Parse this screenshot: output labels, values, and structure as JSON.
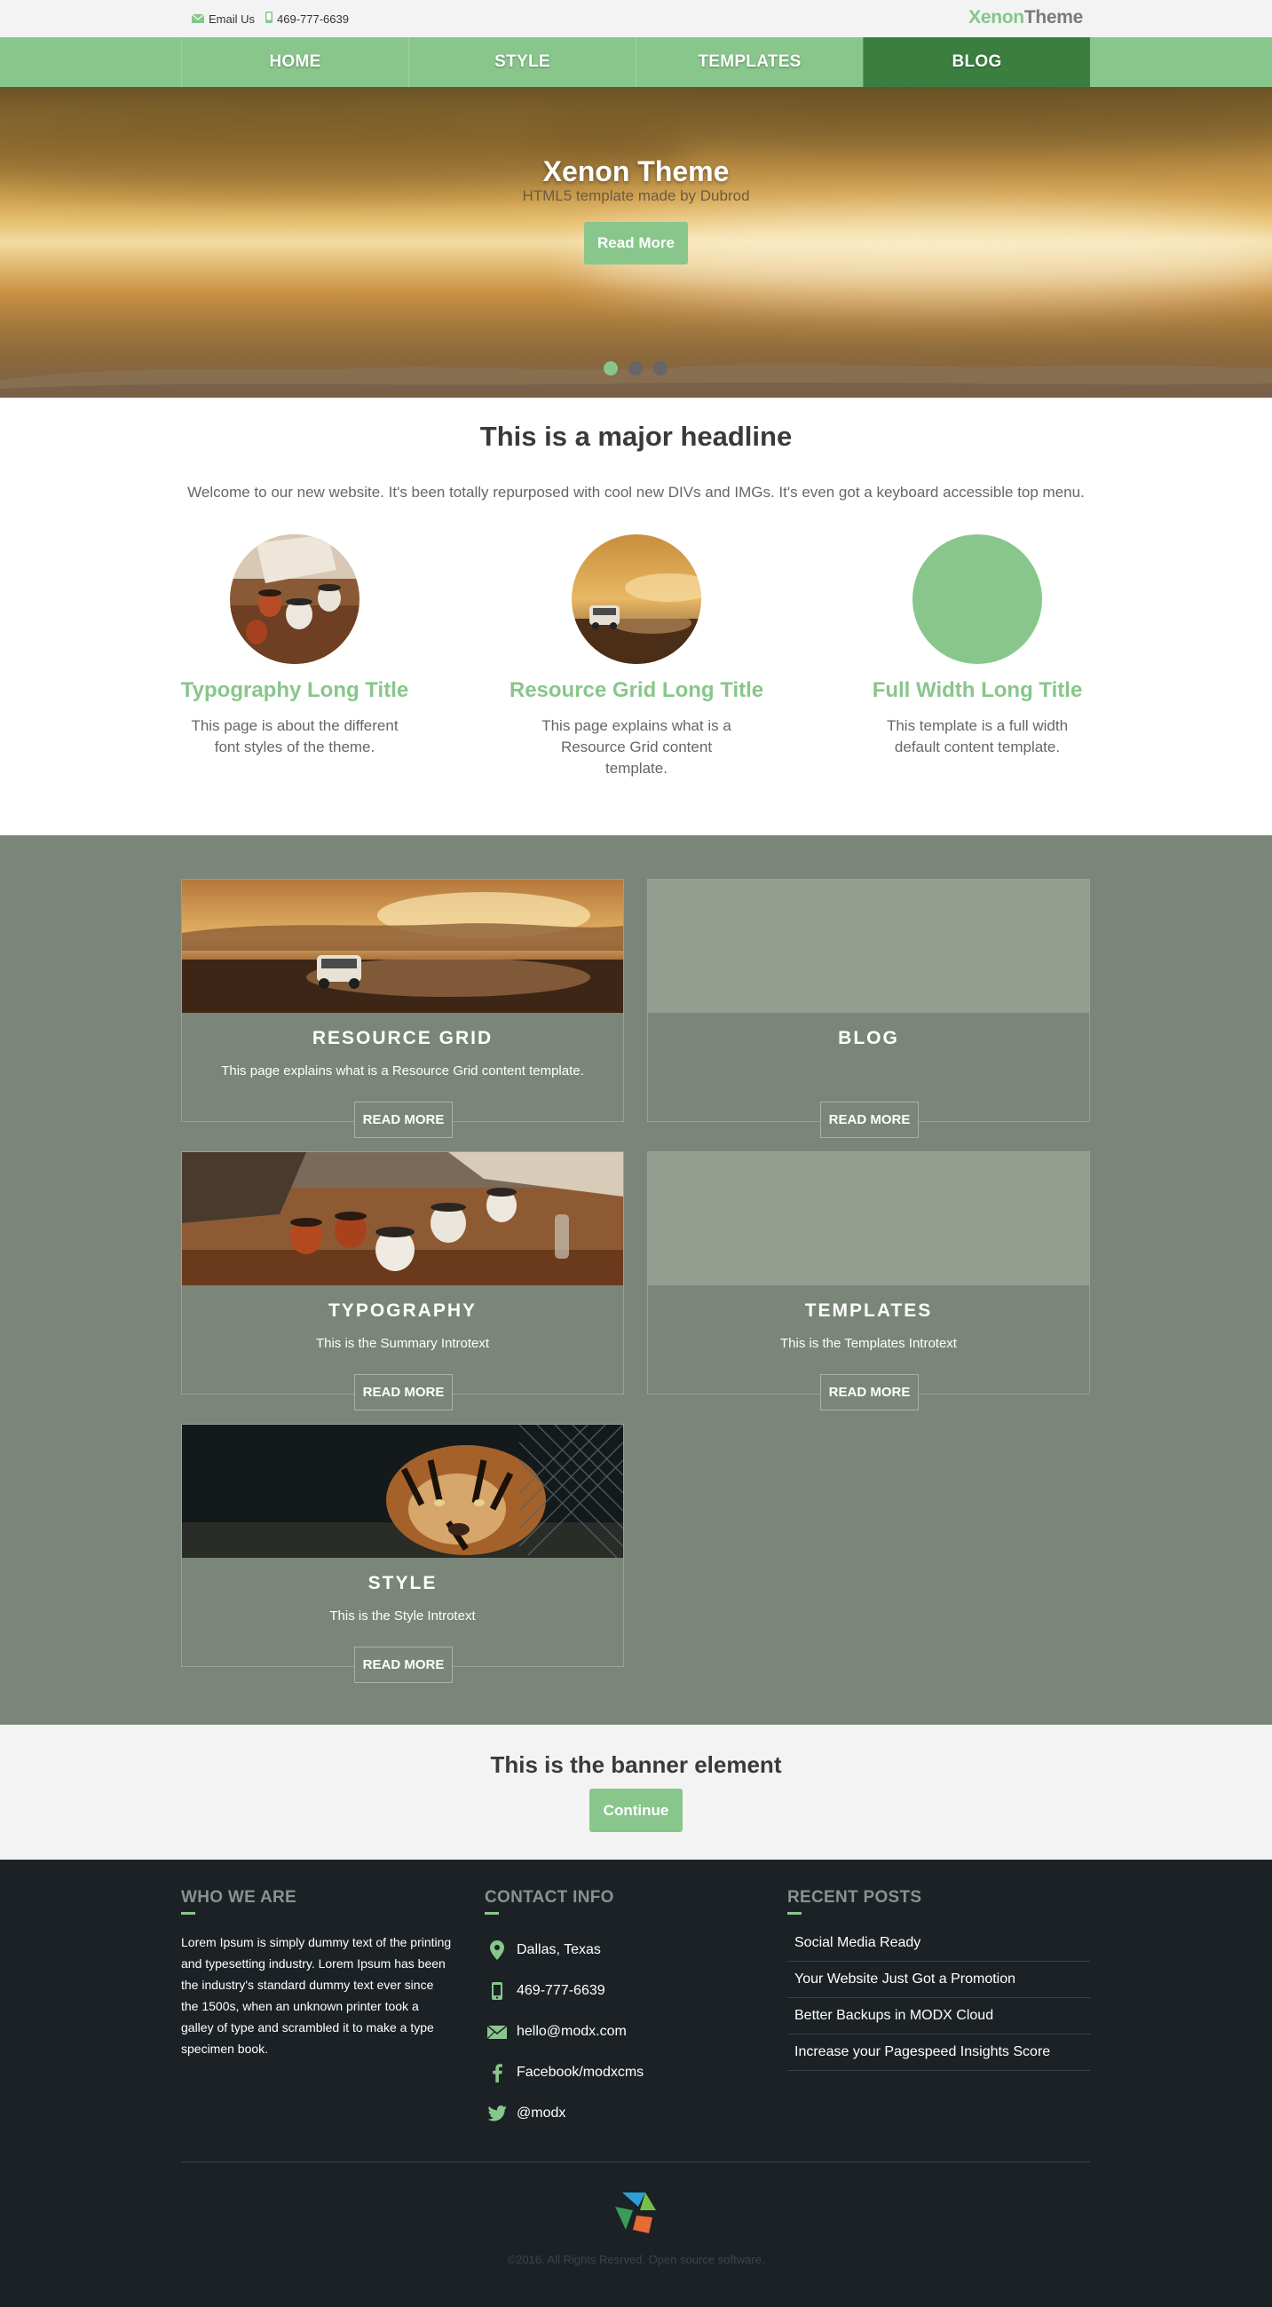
{
  "topbar": {
    "email_label": "Email Us",
    "phone": "469-777-6639",
    "logo_part1": "Xenon",
    "logo_part2": "Theme"
  },
  "nav": {
    "items": [
      {
        "label": "HOME",
        "active": false
      },
      {
        "label": "STYLE",
        "active": false
      },
      {
        "label": "TEMPLATES",
        "active": false
      },
      {
        "label": "BLOG",
        "active": true
      }
    ]
  },
  "hero": {
    "title": "Xenon Theme",
    "subtitle": "HTML5 template made by Dubrod",
    "button": "Read More",
    "slide_count": 3,
    "active_slide": 1
  },
  "intro": {
    "headline": "This is a major headline",
    "text": "Welcome to our new website. It's been totally repurposed with cool new DIVs and IMGs. It's even got a keyboard accessible top menu.",
    "features": [
      {
        "title": "Typography Long Title",
        "text": "This page is about the different font styles of the theme.",
        "image": "mugs-photo"
      },
      {
        "title": "Resource Grid Long Title",
        "text": "This page explains what is a Resource Grid content template.",
        "image": "car-sunset-photo"
      },
      {
        "title": "Full Width Long Title",
        "text": "This template is a full width default content template.",
        "image": "none"
      }
    ]
  },
  "grid": {
    "cards": [
      {
        "title": "RESOURCE GRID",
        "text": "This page explains what is a Resource Grid content template.",
        "button": "READ MORE",
        "image": "car-desert-photo"
      },
      {
        "title": "BLOG",
        "text": "",
        "button": "READ MORE",
        "image": "none"
      },
      {
        "title": "TYPOGRAPHY",
        "text": "This is the Summary Introtext",
        "button": "READ MORE",
        "image": "mugs-photo"
      },
      {
        "title": "TEMPLATES",
        "text": "This is the Templates Introtext",
        "button": "READ MORE",
        "image": "none"
      },
      {
        "title": "STYLE",
        "text": "This is the Style Introtext",
        "button": "READ MORE",
        "image": "tiger-photo"
      }
    ]
  },
  "banner": {
    "title": "This is the banner element",
    "button": "Continue"
  },
  "footer": {
    "who": {
      "heading": "WHO WE ARE",
      "text": "Lorem Ipsum is simply dummy text of the printing and typesetting industry. Lorem Ipsum has been the industry's standard dummy text ever since the 1500s, when an unknown printer took a galley of type and scrambled it to make a type specimen book."
    },
    "contact": {
      "heading": "CONTACT INFO",
      "items": [
        {
          "icon": "map-pin-icon",
          "text": "Dallas, Texas"
        },
        {
          "icon": "phone-icon",
          "text": "469-777-6639"
        },
        {
          "icon": "envelope-icon",
          "text": "hello@modx.com"
        },
        {
          "icon": "facebook-icon",
          "text": "Facebook/modxcms"
        },
        {
          "icon": "twitter-icon",
          "text": "@modx"
        }
      ]
    },
    "posts": {
      "heading": "RECENT POSTS",
      "items": [
        "Social Media Ready",
        "Your Website Just Got a Promotion",
        "Better Backups in MODX Cloud",
        "Increase your Pagespeed Insights Score"
      ]
    },
    "copyright": "©2016. All Rights Resrved. Open source software."
  },
  "colors": {
    "accent": "#88c68b",
    "nav_active": "#3b7f40",
    "grid_bg": "#7b8579",
    "footer_bg": "#1b2124",
    "banner_bg": "#f3f3f3"
  }
}
